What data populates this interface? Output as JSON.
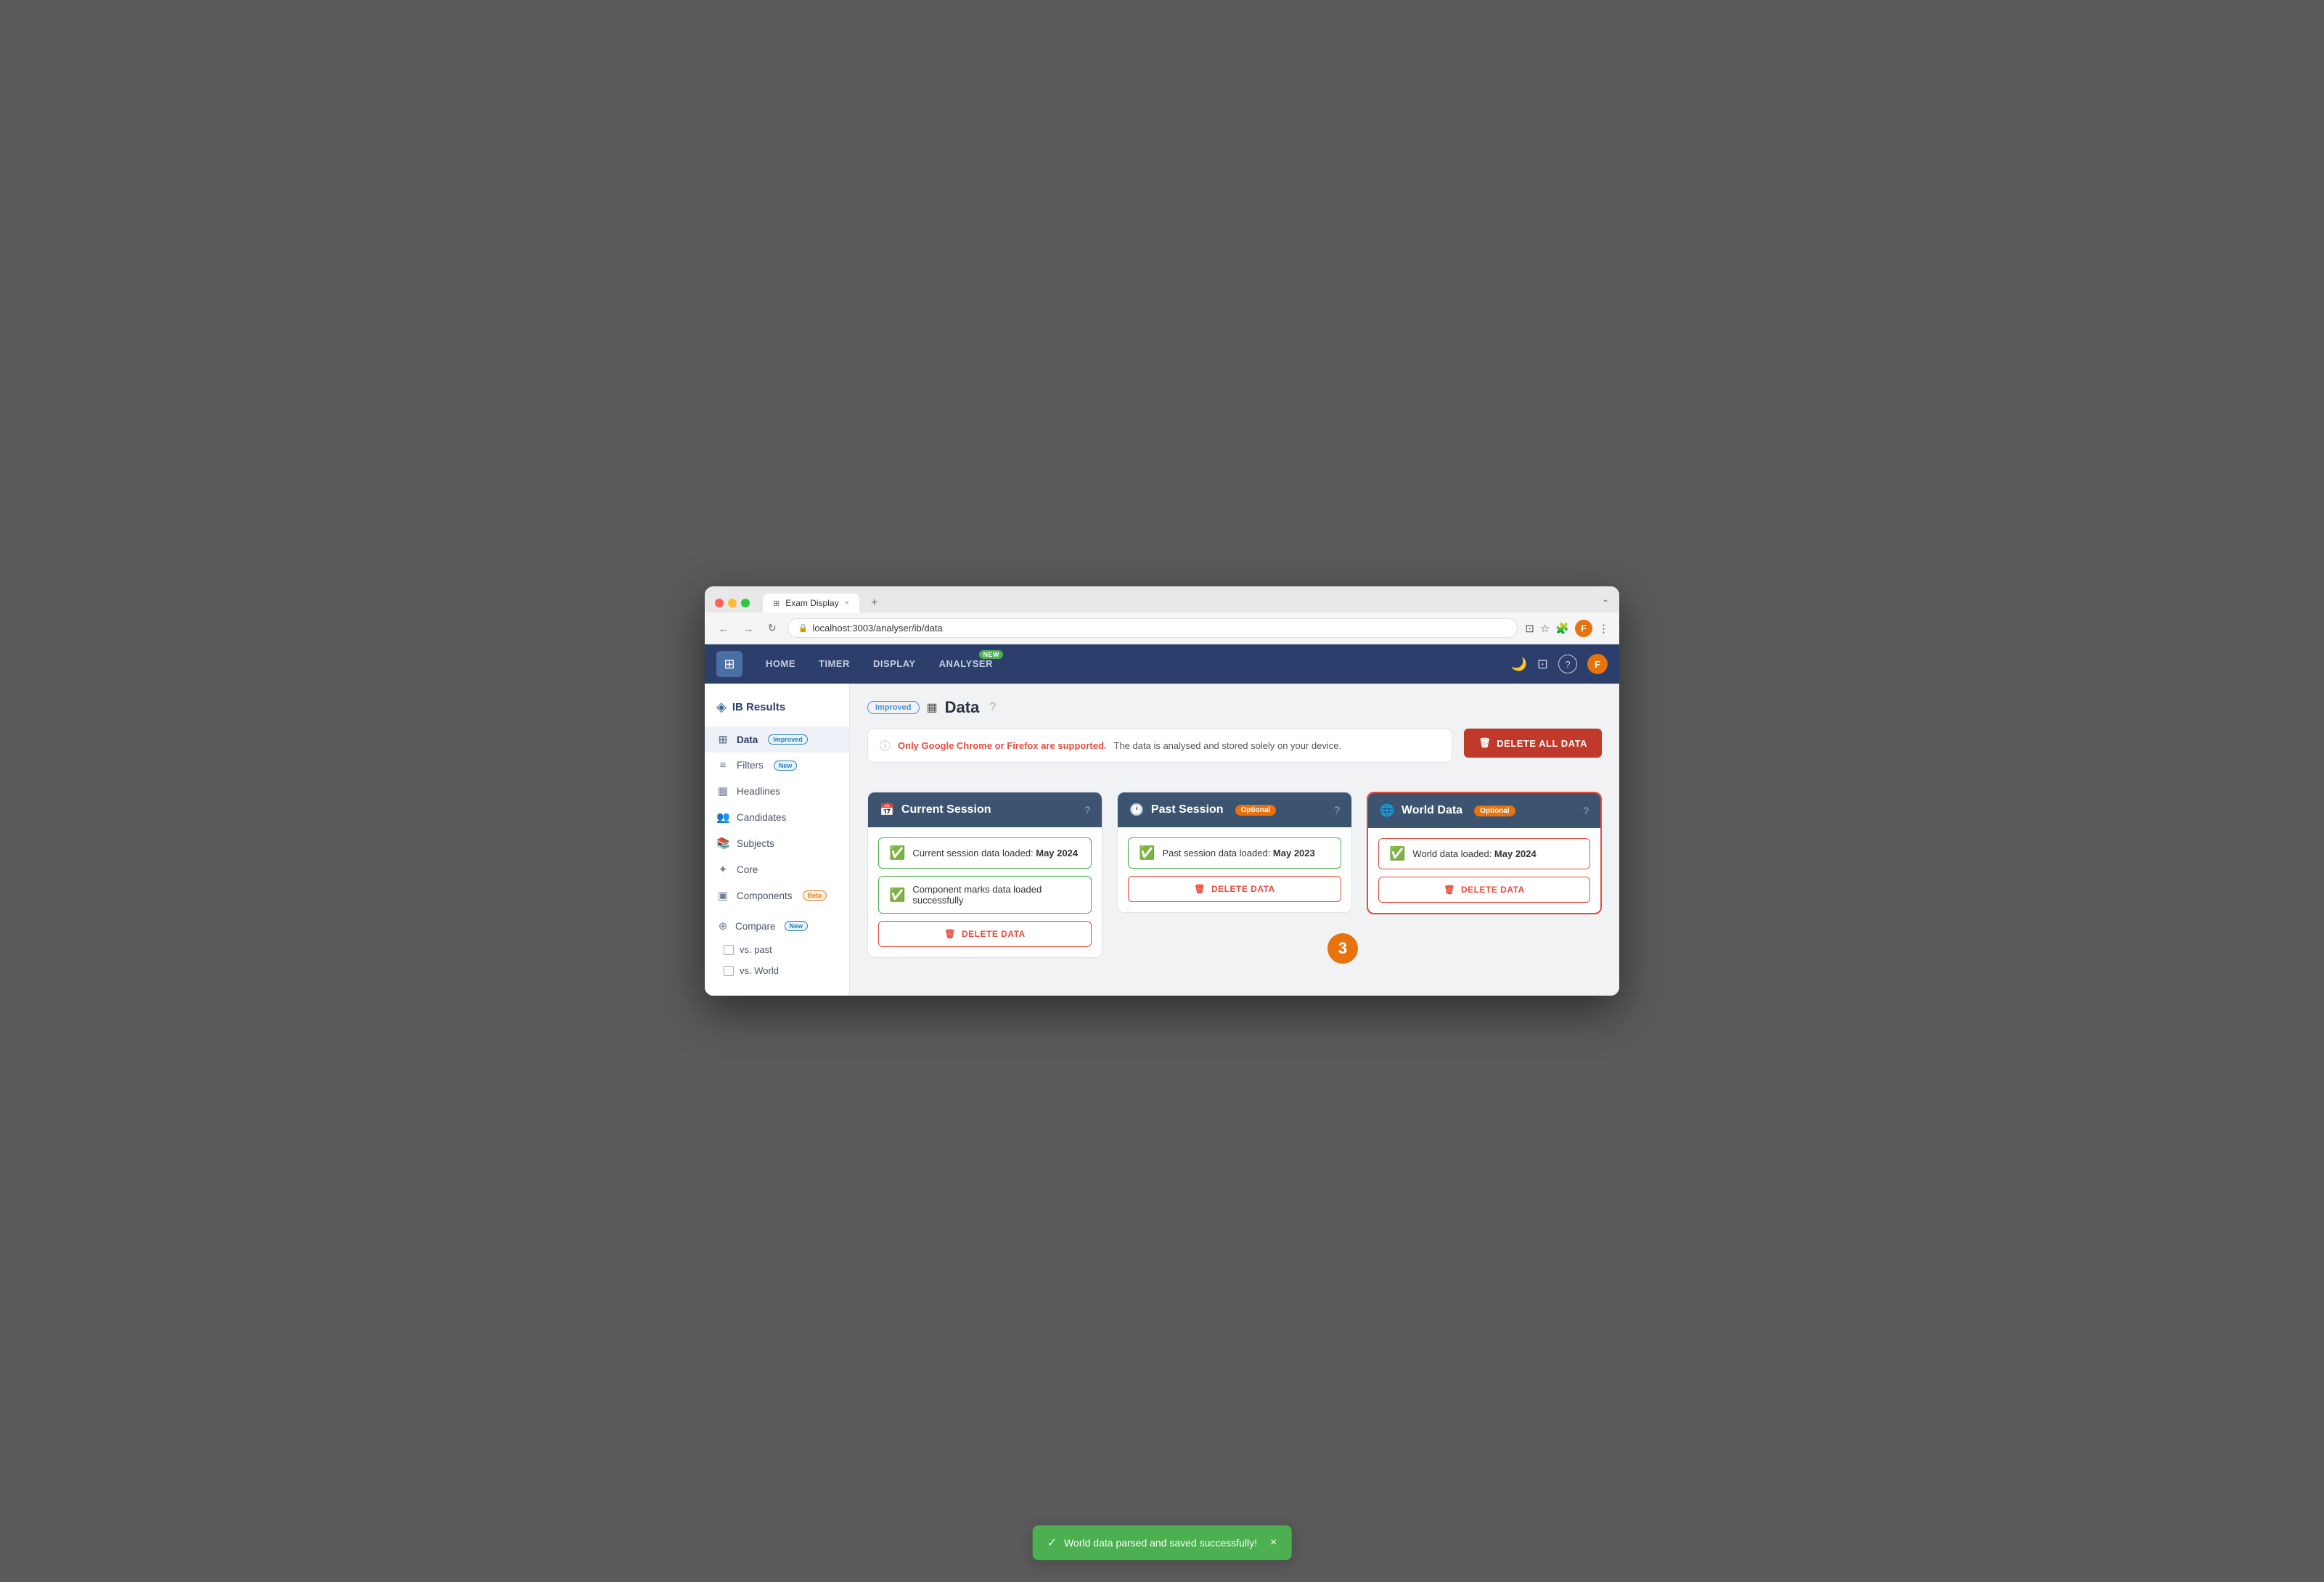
{
  "browser": {
    "tab_title": "Exam Display",
    "tab_close": "×",
    "tab_add": "+",
    "url": "localhost:3003/analyser/ib/data",
    "back_btn": "←",
    "forward_btn": "→",
    "refresh_btn": "↻",
    "expand_icon": "⌃",
    "user_initial": "F"
  },
  "nav": {
    "logo_icon": "⊞",
    "items": [
      {
        "label": "HOME",
        "badge": null
      },
      {
        "label": "TIMER",
        "badge": null
      },
      {
        "label": "DISPLAY",
        "badge": null
      },
      {
        "label": "ANALYSER",
        "badge": "New"
      }
    ],
    "icons": {
      "moon": "🌙",
      "monitor": "⊡",
      "help": "?",
      "user": "👤"
    },
    "user_initial": "F"
  },
  "sidebar": {
    "title": "IB Results",
    "logo_icon": "◈",
    "items": [
      {
        "label": "Data",
        "icon": "⊞",
        "badge": "Improved",
        "badge_type": "improved",
        "active": true
      },
      {
        "label": "Filters",
        "icon": "≡",
        "badge": "New",
        "badge_type": "new",
        "active": false
      },
      {
        "label": "Headlines",
        "icon": "▦",
        "badge": null,
        "active": false
      },
      {
        "label": "Candidates",
        "icon": "👥",
        "badge": null,
        "active": false
      },
      {
        "label": "Subjects",
        "icon": "📚",
        "badge": null,
        "active": false
      },
      {
        "label": "Core",
        "icon": "✦",
        "badge": null,
        "active": false
      },
      {
        "label": "Components",
        "icon": "▣",
        "badge": "Beta",
        "badge_type": "beta",
        "active": false
      }
    ],
    "compare": {
      "label": "Compare",
      "badge": "New",
      "badge_type": "new",
      "sub_items": [
        {
          "label": "vs. past",
          "checked": false
        },
        {
          "label": "vs. World",
          "checked": false
        }
      ]
    }
  },
  "page": {
    "badge": "Improved",
    "data_icon": "▦",
    "title": "Data",
    "help_icon": "?",
    "info_text_red": "Only Google Chrome or Firefox are supported.",
    "info_text": " The data is analysed and stored solely on your device.",
    "info_icon": "ⓘ",
    "delete_all_label": "DELETE ALL DATA",
    "delete_icon": "🗑"
  },
  "cards": [
    {
      "id": "current-session",
      "icon": "📅",
      "title": "Current Session",
      "optional_badge": null,
      "help_icon": "?",
      "highlighted": false,
      "status_items": [
        {
          "text": "Current session data loaded: ",
          "bold": "May 2024"
        },
        {
          "text": "Component marks data loaded successfully",
          "bold": null
        }
      ],
      "delete_label": "DELETE DATA",
      "delete_icon": "🗑"
    },
    {
      "id": "past-session",
      "icon": "🕐",
      "title": "Past Session",
      "optional_badge": "Optional",
      "help_icon": "?",
      "highlighted": false,
      "status_items": [
        {
          "text": "Past session data loaded: ",
          "bold": "May 2023"
        }
      ],
      "delete_label": "DELETE DATA",
      "delete_icon": "🗑",
      "step": "3"
    },
    {
      "id": "world-data",
      "icon": "🌐",
      "title": "World Data",
      "optional_badge": "Optional",
      "help_icon": "?",
      "highlighted": true,
      "status_items": [
        {
          "text": "World data loaded: ",
          "bold": "May 2024"
        }
      ],
      "delete_label": "DELETE DATA",
      "delete_icon": "🗑"
    }
  ],
  "toast": {
    "check_icon": "✓",
    "message": "World data parsed and saved successfully!",
    "close_icon": "×"
  }
}
